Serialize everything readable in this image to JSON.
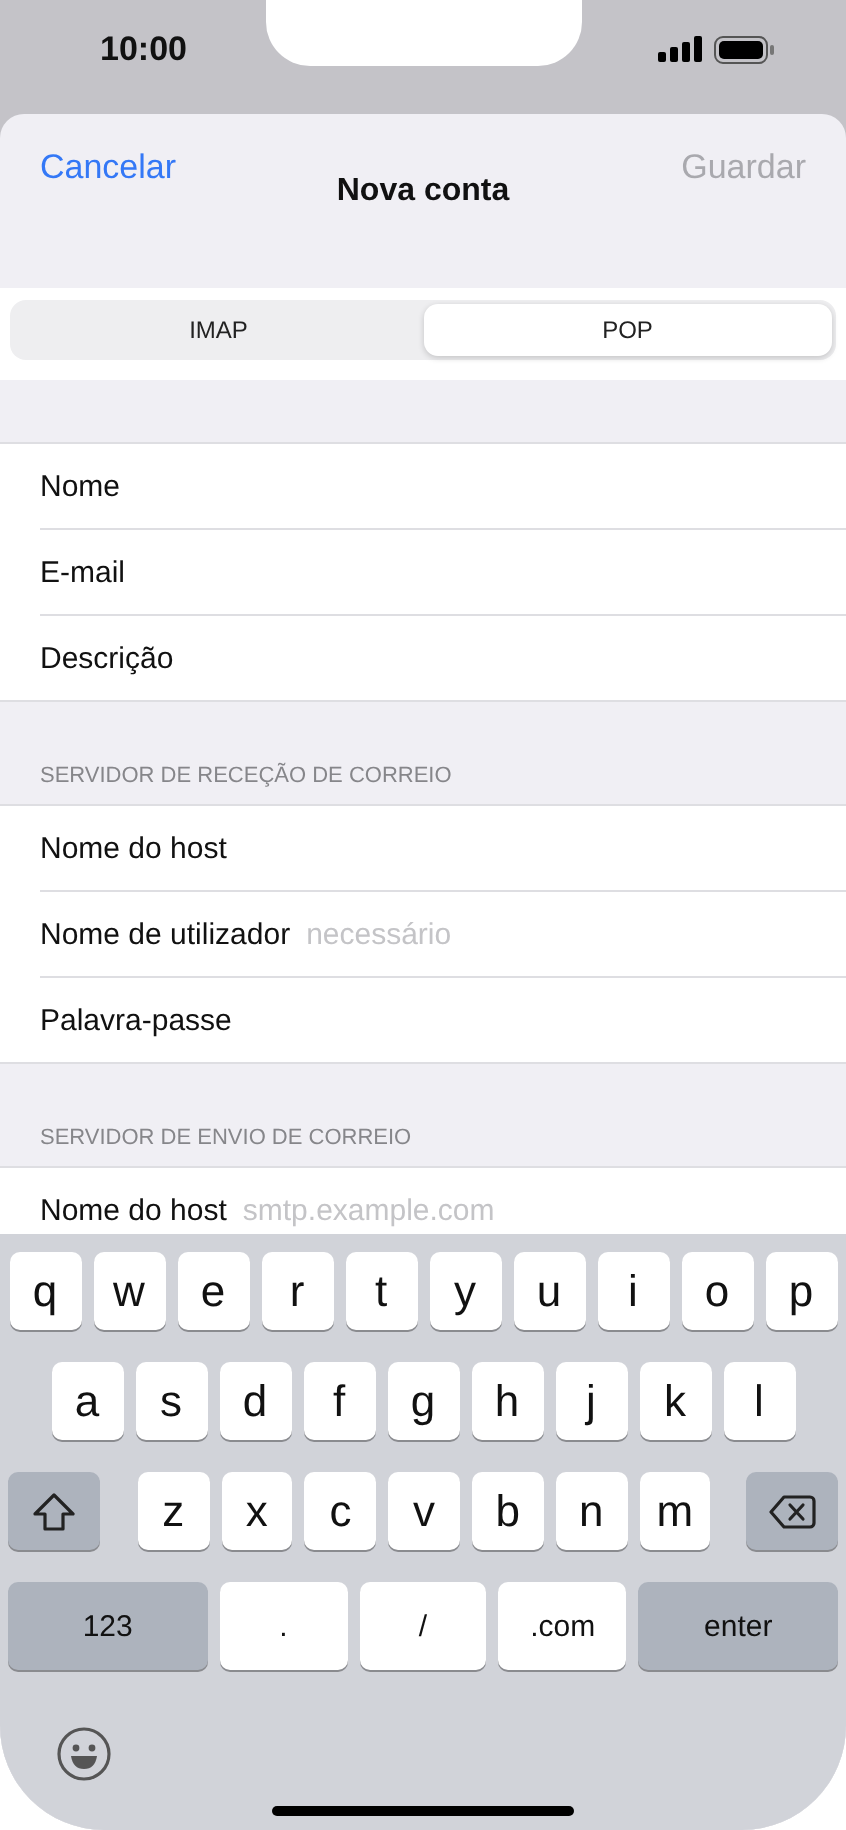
{
  "status_bar": {
    "time": "10:00"
  },
  "nav": {
    "cancel": "Cancelar",
    "title": "Nova conta",
    "save": "Guardar",
    "save_disabled": true
  },
  "segments": [
    {
      "label": "IMAP",
      "selected": false
    },
    {
      "label": "POP",
      "selected": true
    }
  ],
  "sections": [
    {
      "fields": [
        {
          "label": "Nome"
        },
        {
          "label": "E-mail"
        },
        {
          "label": "Descrição"
        }
      ]
    },
    {
      "header": "SERVIDOR DE RECEÇÃO DE CORREIO",
      "fields": [
        {
          "label": "Nome do host"
        },
        {
          "label": "Nome de utilizador",
          "placeholder": "necessário"
        },
        {
          "label": "Palavra-passe"
        }
      ]
    },
    {
      "header": "SERVIDOR DE ENVIO DE CORREIO",
      "fields": [
        {
          "label": "Nome do host",
          "placeholder": "smtp.example.com"
        }
      ]
    }
  ],
  "keyboard": {
    "rows": [
      {
        "keys": [
          {
            "label": "q",
            "kind": "letter"
          },
          {
            "label": "w",
            "kind": "letter"
          },
          {
            "label": "e",
            "kind": "letter"
          },
          {
            "label": "r",
            "kind": "letter"
          },
          {
            "label": "t",
            "kind": "letter"
          },
          {
            "label": "y",
            "kind": "letter"
          },
          {
            "label": "u",
            "kind": "letter"
          },
          {
            "label": "i",
            "kind": "letter"
          },
          {
            "label": "o",
            "kind": "letter"
          },
          {
            "label": "p",
            "kind": "letter"
          }
        ]
      },
      {
        "keys": [
          {
            "label": "a",
            "kind": "letter"
          },
          {
            "label": "s",
            "kind": "letter"
          },
          {
            "label": "d",
            "kind": "letter"
          },
          {
            "label": "f",
            "kind": "letter"
          },
          {
            "label": "g",
            "kind": "letter"
          },
          {
            "label": "h",
            "kind": "letter"
          },
          {
            "label": "j",
            "kind": "letter"
          },
          {
            "label": "k",
            "kind": "letter"
          },
          {
            "label": "l",
            "kind": "letter"
          }
        ]
      },
      {
        "keys": [
          {
            "kind": "shift"
          },
          {
            "label": "z",
            "kind": "letter"
          },
          {
            "label": "x",
            "kind": "letter"
          },
          {
            "label": "c",
            "kind": "letter"
          },
          {
            "label": "v",
            "kind": "letter"
          },
          {
            "label": "b",
            "kind": "letter"
          },
          {
            "label": "n",
            "kind": "letter"
          },
          {
            "label": "m",
            "kind": "letter"
          },
          {
            "kind": "backspace"
          }
        ]
      },
      {
        "keys": [
          {
            "label": "123",
            "kind": "function"
          },
          {
            "label": ".",
            "kind": "symbol"
          },
          {
            "label": "/",
            "kind": "symbol"
          },
          {
            "label": ".com",
            "kind": "symbol"
          },
          {
            "label": "enter",
            "kind": "function"
          }
        ]
      }
    ]
  }
}
